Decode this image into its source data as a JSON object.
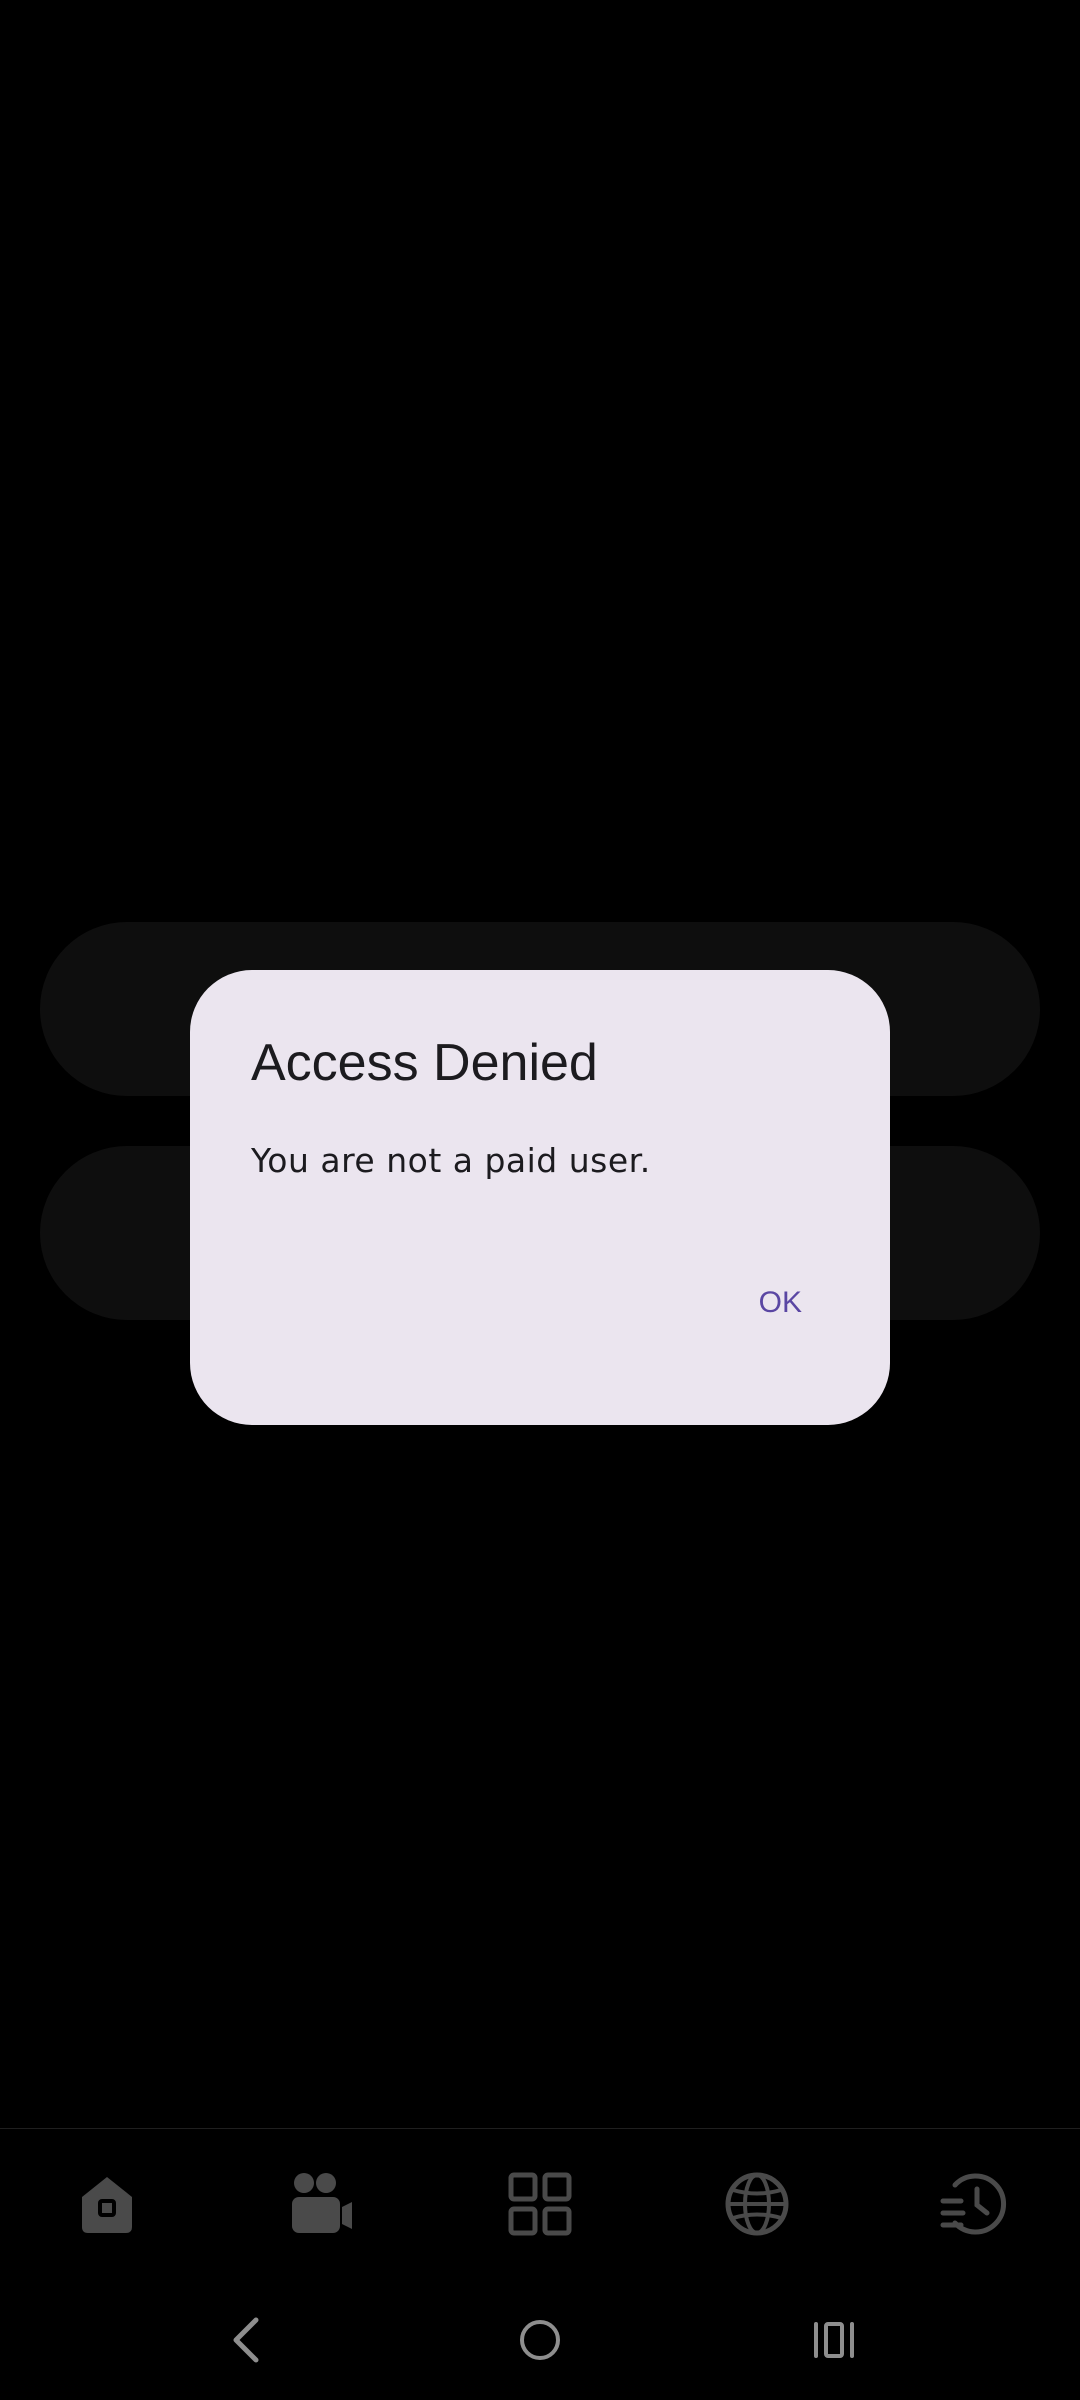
{
  "dialog": {
    "title": "Access Denied",
    "message": "You are not a paid user.",
    "ok_label": "OK"
  },
  "colors": {
    "background": "#000000",
    "dialog_surface": "#ebe5ef",
    "dialog_text": "#1c1b1f",
    "accent": "#5a46a3",
    "nav_icon": "#4a4a4a"
  },
  "bottom_nav": {
    "items": [
      {
        "icon": "home-icon"
      },
      {
        "icon": "group-video-icon"
      },
      {
        "icon": "grid-icon"
      },
      {
        "icon": "globe-icon"
      },
      {
        "icon": "history-icon"
      }
    ]
  },
  "system_nav": {
    "buttons": [
      {
        "icon": "back-icon"
      },
      {
        "icon": "home-circle-icon"
      },
      {
        "icon": "recents-icon"
      }
    ]
  }
}
